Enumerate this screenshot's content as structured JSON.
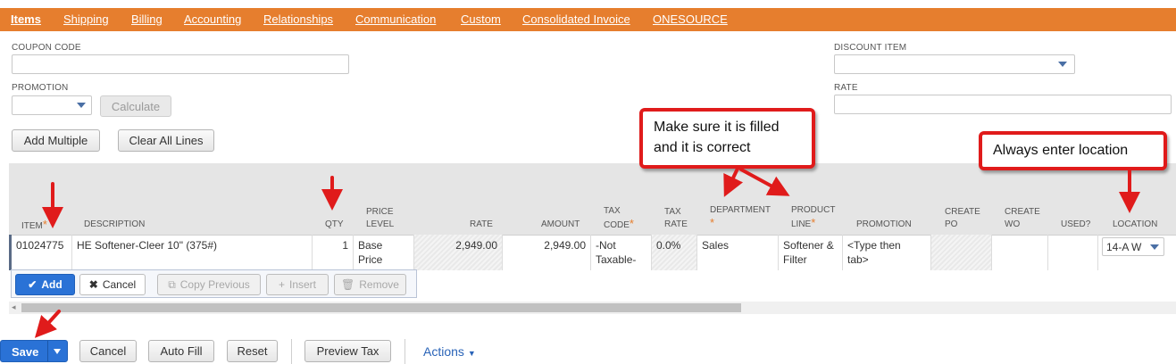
{
  "tabs": [
    {
      "label": "Items",
      "active": true
    },
    {
      "label": "Shipping"
    },
    {
      "label": "Billing"
    },
    {
      "label": "Accounting"
    },
    {
      "label": "Relationships"
    },
    {
      "label": "Communication"
    },
    {
      "label": "Custom"
    },
    {
      "label": "Consolidated Invoice"
    },
    {
      "label": "ONESOURCE"
    }
  ],
  "form": {
    "coupon_code_label": "COUPON CODE",
    "coupon_code_value": "",
    "promotion_label": "PROMOTION",
    "promotion_value": "",
    "calculate_label": "Calculate",
    "discount_item_label": "DISCOUNT ITEM",
    "discount_item_value": "",
    "rate_label": "RATE",
    "rate_value": ""
  },
  "grid_buttons": {
    "add_multiple": "Add Multiple",
    "clear_all_lines": "Clear All Lines"
  },
  "columns": {
    "item": "ITEM",
    "description": "DESCRIPTION",
    "qty": "QTY",
    "price_level_1": "PRICE",
    "price_level_2": "LEVEL",
    "rate": "RATE",
    "amount": "AMOUNT",
    "tax_code_1": "TAX",
    "tax_code_2": "CODE",
    "tax_rate_1": "TAX",
    "tax_rate_2": "RATE",
    "department": "DEPARTMENT",
    "product_line_1": "PRODUCT",
    "product_line_2": "LINE",
    "promotion": "PROMOTION",
    "create_po_1": "CREATE",
    "create_po_2": "PO",
    "create_wo_1": "CREATE",
    "create_wo_2": "WO",
    "used": "USED?",
    "location": "LOCATION",
    "required_mark": "*"
  },
  "row": {
    "item": "01024775",
    "description": "HE Softener-Cleer 10\" (375#)",
    "qty": "1",
    "price_level": "Base Price",
    "rate": "2,949.00",
    "amount": "2,949.00",
    "tax_code_1": "-Not",
    "tax_code_2": "Taxable-",
    "tax_rate": "0.0%",
    "department": "Sales",
    "product_line_1": "Softener &",
    "product_line_2": "Filter",
    "promotion_1": "<Type then",
    "promotion_2": "tab>",
    "location": "14-A W"
  },
  "line_actions": {
    "add": "Add",
    "cancel": "Cancel",
    "copy_previous": "Copy Previous",
    "insert": "Insert",
    "remove": "Remove"
  },
  "footer": {
    "save": "Save",
    "cancel": "Cancel",
    "auto_fill": "Auto Fill",
    "reset": "Reset",
    "preview_tax": "Preview Tax",
    "actions": "Actions"
  },
  "annotations": {
    "callout_1_line1": "Make sure it is filled",
    "callout_1_line2": "and it is correct",
    "callout_2": "Always enter location"
  },
  "colors": {
    "tab_bar": "#e67e2e",
    "primary_button": "#2a72d6",
    "annotation_red": "#e01b1b"
  }
}
